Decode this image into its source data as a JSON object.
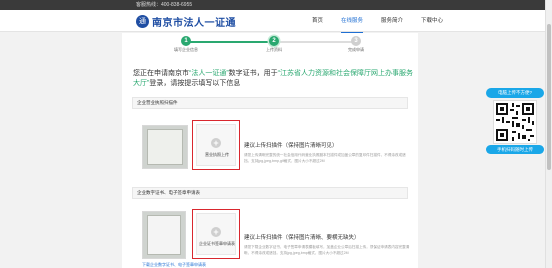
{
  "topbar": {
    "hotline": "客服热线：400-838-6955"
  },
  "header": {
    "logo_mark": "通",
    "logo_text": "南京市法人一证通",
    "nav": [
      {
        "label": "首页",
        "active": false
      },
      {
        "label": "在线服务",
        "active": true
      },
      {
        "label": "服务简介",
        "active": false
      },
      {
        "label": "下载中心",
        "active": false
      }
    ]
  },
  "steps": [
    {
      "num": "1",
      "label": "填写企业信息",
      "state": "done"
    },
    {
      "num": "2",
      "label": "上传资料",
      "state": "active"
    },
    {
      "num": "3",
      "label": "完成申请",
      "state": "todo"
    }
  ],
  "intro": {
    "part1": "您正在申请南京市",
    "highlight1": "“法人一证通”",
    "part2": "数字证书，用于",
    "highlight2": "“江苏省人力资源和社会保障厅网上办事服务大厅”",
    "part3": "登录，请按提示填写以下信息"
  },
  "sections": [
    {
      "title": "企业营业执照扫描件",
      "upload_label": "营业执照上传",
      "hint_title": "建议上传扫描件（保持图片清晰可见）",
      "hint_text": "请您上传清晰完整的统一社会信用代码营业执照副本扫描件或加盖公章的复印件扫描件，不得涂改或遮挡。支持jpg,jpeg,bmp,gif格式，图片大小不超过2M"
    },
    {
      "title": "企业数字证书、电子签章申请表",
      "upload_label": "企业证书签章申请表",
      "hint_title": "建议上传扫描件（保持图片清晰、要横无缺失）",
      "hint_text": "请您下载企业数字证书、电子签章申请表模板填写，加盖企业公章后扫描上传，须保证申请表内容完整清晰，不得涂改或遮挡。支持jpg,jpeg,bmp格式，图片大小不超过2M",
      "link": "下载企业数字证书、电子签章申请表"
    }
  ],
  "qr": {
    "top": "电脑上传不方便?",
    "bottom": "手机扫码随时上传"
  },
  "colors": {
    "brand": "#1f4ea3",
    "accent": "#1f6fd3",
    "highlight": "#2aa870",
    "error": "#d9272e",
    "qr_button": "#1aa7e8"
  }
}
